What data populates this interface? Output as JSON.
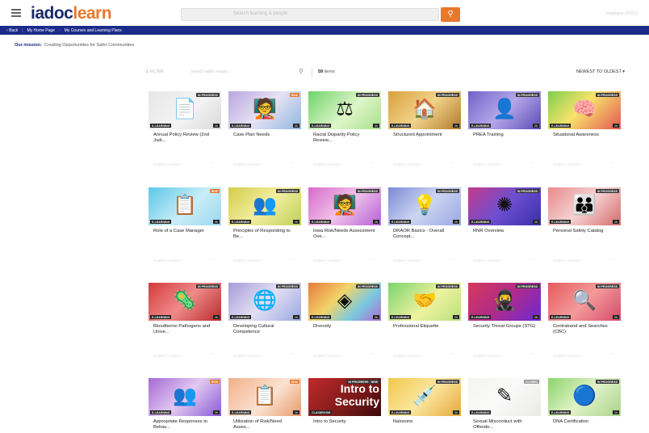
{
  "header": {
    "logo_part1": "iadoc",
    "logo_part2": "learn",
    "search_placeholder": "Search learning & people",
    "user_label": "Employee (IDOC)"
  },
  "breadcrumb": {
    "back": "Back",
    "items": [
      "My Home Page",
      "My Courses and Learning Plans"
    ]
  },
  "mission": {
    "label": "Our mission:",
    "text": "Creating Opportunities for Safer Communities"
  },
  "filters": {
    "label": "FILTER",
    "search_placeholder": "Search within results...",
    "count": "59",
    "items_label": "items",
    "sort": "NEWEST TO OLDEST ▾"
  },
  "colors": {
    "accent": "#e8782a",
    "nav": "#1c2a8a",
    "brand": "#1a2b6b"
  },
  "cards": [
    {
      "title": "Annual Policy Review (2nd Judi...",
      "status": "IN PROGRESS",
      "type": "E-LEARNING",
      "duration": "1h",
      "icon": "document-icon",
      "glyph": "📄",
      "bg": "linear-gradient(135deg,#e6e6e6,#f4f4f4 55%,#d8d8d8)",
      "meta": "English | Custom"
    },
    {
      "title": "Case Plan Needs",
      "status": "NEW",
      "type": "E-LEARNING",
      "duration": "30",
      "icon": "presenter-icon",
      "glyph": "🧑‍🏫",
      "bg": "linear-gradient(135deg,#b9a6e0,#e6e2f3 50%,#8fb6de)",
      "meta": "English | Custom"
    },
    {
      "title": "Racial Disparity Policy Review...",
      "status": "IN PROGRESS",
      "type": "E-LEARNING",
      "duration": "30",
      "icon": "scales-icon",
      "glyph": "⚖",
      "bg": "linear-gradient(135deg,#6fd36a,#dff5c9 55%,#a7e08b)",
      "meta": "English | Custom"
    },
    {
      "title": "Structured Appointment",
      "status": "IN PROGRESS",
      "type": "E-LEARNING",
      "duration": "1h",
      "icon": "house-icon",
      "glyph": "🏠",
      "bg": "linear-gradient(135deg,#d9a13a,#f1d38b 50%,#b07a2a)",
      "meta": "English | Custom"
    },
    {
      "title": "PREA Training",
      "status": "IN PROGRESS",
      "type": "E-LEARNING",
      "duration": "2h",
      "icon": "person-icon",
      "glyph": "👤",
      "bg": "linear-gradient(135deg,#7161c9,#b4a7e8 50%,#5b4ab8)",
      "meta": "English | Custom"
    },
    {
      "title": "Situational Awareness",
      "status": "IN PROGRESS",
      "type": "E-LEARNING",
      "duration": "1h",
      "icon": "head-icon",
      "glyph": "🧠",
      "bg": "linear-gradient(135deg,#7fce4e,#f7e36a 45%,#e65555)",
      "meta": "English | Custom"
    },
    {
      "title": "Role of a Case Manager",
      "status": "NEW",
      "type": "E-LEARNING",
      "duration": "2h",
      "icon": "hand-document-icon",
      "glyph": "📋",
      "bg": "linear-gradient(135deg,#5cc7e8,#c9edf7 55%,#9bd7ee)",
      "meta": "English | Custom"
    },
    {
      "title": "Principles of Responding to Be...",
      "status": "IN PROGRESS",
      "type": "E-LEARNING",
      "duration": "1h",
      "icon": "group-icon",
      "glyph": "👥",
      "bg": "linear-gradient(135deg,#d4cc4a,#f2eea0 50%,#bfcf58)",
      "meta": "English | Custom"
    },
    {
      "title": "Iowa Risk/Needs Assessment Ove...",
      "status": "IN PROGRESS",
      "type": "E-LEARNING",
      "duration": "1h",
      "icon": "presenter-icon",
      "glyph": "🧑‍🏫",
      "bg": "linear-gradient(135deg,#d76ac9,#f0c2ea 50%,#b45fd4)",
      "meta": "English | Custom"
    },
    {
      "title": "DRAOR Basics - Overall Concept...",
      "status": "IN PROGRESS",
      "type": "E-LEARNING",
      "duration": "1h",
      "icon": "lightbulb-icon",
      "glyph": "💡",
      "bg": "linear-gradient(135deg,#7a8ad6,#cdd4f2 50%,#9aa8e2)",
      "meta": "English | Custom"
    },
    {
      "title": "RNR Overview",
      "status": "IN PROGRESS",
      "type": "E-LEARNING",
      "duration": "1h",
      "icon": "network-icon",
      "glyph": "✺",
      "bg": "linear-gradient(135deg,#c53a8a,#6d4fd1 50%,#3a2fa8)",
      "meta": "English | Custom"
    },
    {
      "title": "Personal Safety Catalog",
      "status": "IN PROGRESS",
      "type": "E-LEARNING",
      "duration": "1h",
      "icon": "people-icon",
      "glyph": "👪",
      "bg": "linear-gradient(135deg,#e88a8a,#f6d2d2 50%,#d46a6a)",
      "meta": "English | Custom"
    },
    {
      "title": "Bloodborne Pathogens and Unive...",
      "status": "IN PROGRESS",
      "type": "E-LEARNING",
      "duration": "1h",
      "icon": "virus-icon",
      "glyph": "🦠",
      "bg": "linear-gradient(135deg,#d43a3a,#f08a8a 50%,#b82a2a)",
      "meta": "English | Custom"
    },
    {
      "title": "Developing Cultural Competence",
      "status": "IN PROGRESS",
      "type": "E-LEARNING",
      "duration": "1h",
      "icon": "globe-person-icon",
      "glyph": "🌐",
      "bg": "linear-gradient(135deg,#a49bd8,#e2dff4 50%,#9aa7e0)",
      "meta": "English | Custom"
    },
    {
      "title": "Diversity",
      "status": "IN PROGRESS",
      "type": "E-LEARNING",
      "duration": "2h",
      "icon": "shapes-icon",
      "glyph": "◈",
      "bg": "linear-gradient(135deg,#e67a3a,#f2d46a 40%,#7ac9e0 70%,#b06ad4)",
      "meta": "English | Custom"
    },
    {
      "title": "Professional Etiquette",
      "status": "IN PROGRESS",
      "type": "E-LEARNING",
      "duration": "2h",
      "icon": "handshake-head-icon",
      "glyph": "🤝",
      "bg": "linear-gradient(135deg,#7ad46a,#eef2a0 55%,#b8e07a)",
      "meta": "English | Custom"
    },
    {
      "title": "Security Threat Groups (STG)",
      "status": "IN PROGRESS",
      "type": "E-LEARNING",
      "duration": "1h",
      "icon": "masked-faces-icon",
      "glyph": "🥷",
      "bg": "linear-gradient(135deg,#d43a5a,#b02a8a 50%,#6a2ad4)",
      "meta": "English | Custom"
    },
    {
      "title": "Contraband and Searches (CBC)",
      "status": "IN PROGRESS",
      "type": "E-LEARNING",
      "duration": "2h",
      "icon": "magnifier-icon",
      "glyph": "🔍",
      "bg": "linear-gradient(135deg,#e65a5a,#f49a9a 50%,#d44a6a)",
      "meta": "English | Custom"
    },
    {
      "title": "Appropriate Responses to Behav...",
      "status": "NEW",
      "type": "E-LEARNING",
      "duration": "2h",
      "icon": "team-network-icon",
      "glyph": "👥",
      "bg": "linear-gradient(135deg,#a46ad4,#e2c8f2 50%,#8a5ad4)",
      "meta": ""
    },
    {
      "title": "Utilization of Risk/Need Asses...",
      "status": "NEW",
      "type": "E-LEARNING",
      "duration": "1h",
      "icon": "clipboard-icon",
      "glyph": "📋",
      "bg": "linear-gradient(135deg,#f2b08a,#fbe2d2 55%,#e69a6a)",
      "meta": ""
    },
    {
      "title": "Intro to Security",
      "status": "IN PROGRESS · NEW",
      "type": "CLASSROOM",
      "duration": "",
      "icon": "text-banner-icon",
      "glyph": "",
      "intro": "Intro to Security",
      "bg": "linear-gradient(135deg,#c22a2a,#7a1a1a 60%,#3a0a0a)",
      "meta": ""
    },
    {
      "title": "Naloxone",
      "status": "IN PROGRESS",
      "type": "E-LEARNING",
      "duration": "2h",
      "icon": "syringe-icon",
      "glyph": "💉",
      "bg": "linear-gradient(135deg,#f2c84a,#fbe6a0 50%,#e6a83a)",
      "meta": ""
    },
    {
      "title": "Sexual Misconduct with Offende...",
      "status": "CLOSED",
      "type": "E-LEARNING",
      "duration": "",
      "icon": "sketch-icon",
      "glyph": "✎",
      "bg": "linear-gradient(135deg,#f4f4f0,#fafafa 50%,#eaeae4)",
      "meta": ""
    },
    {
      "title": "DNA Certification",
      "status": "IN PROGRESS",
      "type": "E-LEARNING",
      "duration": "1h",
      "icon": "seal-icon",
      "glyph": "🔵",
      "bg": "linear-gradient(135deg,#8ad46a,#e2f2c8 50%,#a8d48a)",
      "meta": ""
    }
  ]
}
